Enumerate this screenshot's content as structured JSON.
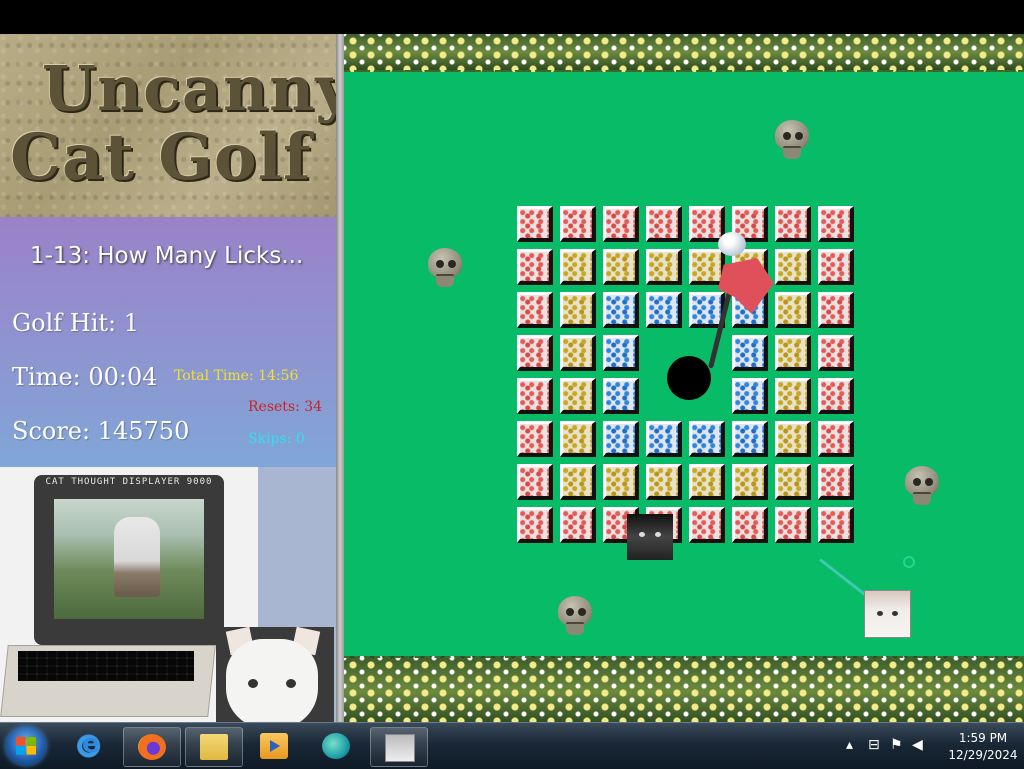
{
  "logo": {
    "line1": "Uncanny",
    "line2": "Cat Golf"
  },
  "hud": {
    "level_title": "1-13: How Many Licks...",
    "golf_hit": "Golf Hit: 1",
    "time": "Time: 00:04",
    "total_time": "Total Time: 14:56",
    "resets": "Resets: 34",
    "skips": "Skips: 0",
    "score": "Score: 145750"
  },
  "displayer": {
    "label": "CAT THOUGHT DISPLAYER 9000"
  },
  "board": {
    "colors": {
      "r": "#e65a5a",
      "y": "#c8a820",
      "b": "#2e86e0"
    },
    "grid": [
      "rrrrrrrr",
      "ryyyyyyr",
      "rybbbbyr",
      "ryb..byr",
      "ryb..byr",
      "rybbbbyr",
      "ryyyyyyr",
      "rrrrrrrr"
    ]
  },
  "field": {
    "background_color": "#08bb67",
    "objects": [
      "skull-icon",
      "skull-icon",
      "skull-icon",
      "skull-icon",
      "golf-flag",
      "golf-hole",
      "cat-ball",
      "dark-cat"
    ]
  },
  "taskbar": {
    "apps": [
      "internet-explorer-icon",
      "firefox-icon",
      "folder-icon",
      "media-player-icon",
      "edge-icon",
      "uncanny-cat-golf-icon"
    ],
    "clock_time": "1:59 PM",
    "clock_date": "12/29/2024"
  }
}
